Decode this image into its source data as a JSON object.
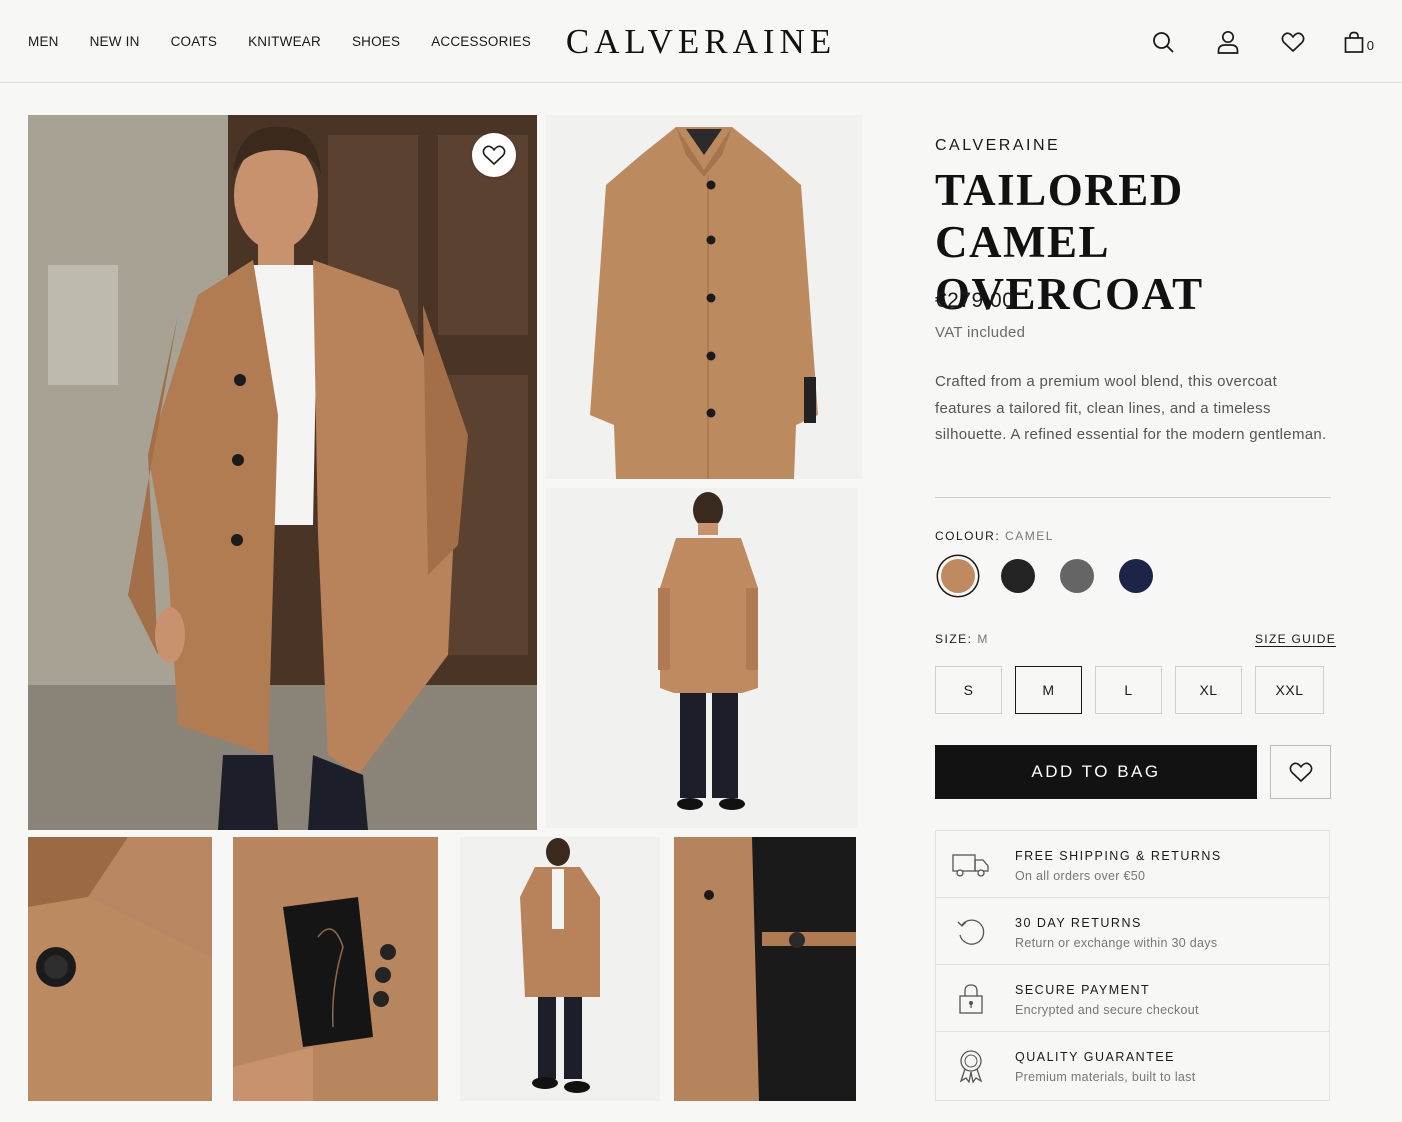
{
  "header": {
    "nav": [
      "MEN",
      "NEW IN",
      "COATS",
      "KNITWEAR",
      "SHOES",
      "ACCESSORIES"
    ],
    "logo": "CALVERAINE",
    "icons": [
      "search-icon",
      "account-icon",
      "wishlist-icon",
      "bag-icon"
    ],
    "bag_count": "0"
  },
  "gallery": {
    "images": [
      "model-street-camel-coat",
      "coat-front-flatlay",
      "model-back-view",
      "collar-button-detail",
      "sleeve-patch-detail",
      "model-full-front",
      "inner-lining-detail"
    ]
  },
  "product": {
    "brand": "CALVERAINE",
    "title": "TAILORED CAMEL OVERCOAT",
    "price": "€279,00",
    "vat": "VAT included",
    "description": "Crafted from a premium wool blend, this overcoat features a tailored fit, clean lines, and a timeless silhouette. A refined essential for the modern gentleman.",
    "colour_label": "COLOUR:",
    "colour_selected": "CAMEL",
    "colours": [
      {
        "name": "camel",
        "hex": "#bf8a60"
      },
      {
        "name": "black",
        "hex": "#232323"
      },
      {
        "name": "grey",
        "hex": "#656565"
      },
      {
        "name": "navy",
        "hex": "#1c2547"
      }
    ],
    "size_label": "SIZE:",
    "size_selected": "M",
    "size_guide": "SIZE GUIDE",
    "sizes": [
      "S",
      "M",
      "L",
      "XL",
      "XXL"
    ],
    "add_to_bag": "ADD TO BAG"
  },
  "features": [
    {
      "icon": "truck-icon",
      "title": "FREE SHIPPING & RETURNS",
      "subtitle": "On all orders over €50"
    },
    {
      "icon": "return-icon",
      "title": "30 DAY RETURNS",
      "subtitle": "Return or exchange within 30 days"
    },
    {
      "icon": "lock-icon",
      "title": "SECURE PAYMENT",
      "subtitle": "Encrypted and secure checkout"
    },
    {
      "icon": "award-icon",
      "title": "QUALITY GUARANTEE",
      "subtitle": "Premium materials, built to last"
    }
  ],
  "colors": {
    "accent": "#121212",
    "background": "#f7f7f6",
    "camel": "#bf8a60"
  }
}
